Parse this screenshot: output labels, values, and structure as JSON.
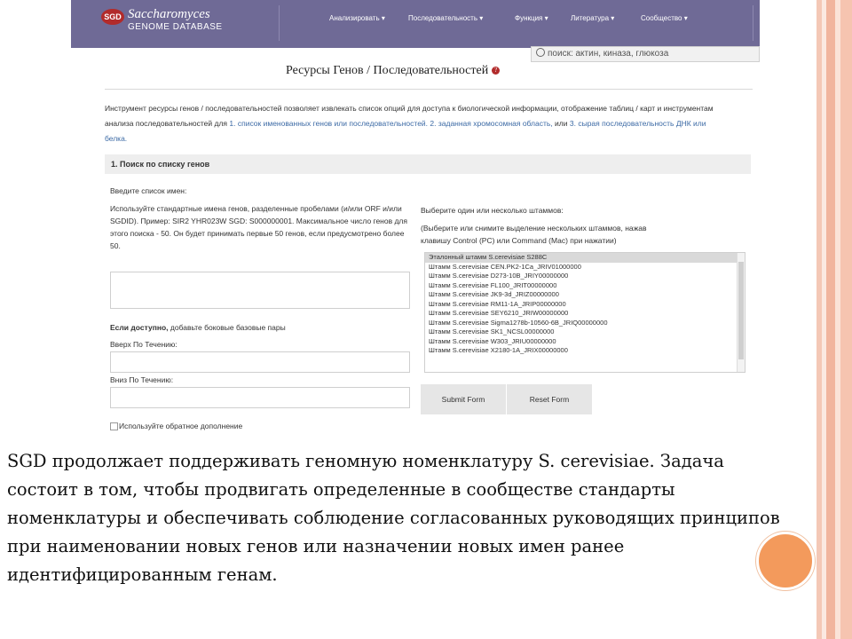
{
  "site": {
    "logo_text": "SGD",
    "brand_line1": "Saccharomyces",
    "brand_line2": "GENOME DATABASE"
  },
  "nav": {
    "items": [
      "Анализировать",
      "Последовательность",
      "Функция",
      "Литература",
      "Сообщество"
    ],
    "search_placeholder": "поиск: актин, киназа, глюкоза"
  },
  "page": {
    "title": "Ресурсы Генов / Последовательностей",
    "intro_part1": "Инструмент ресурсы генов / последовательностей позволяет извлекать список опций для доступа к биологической информации, отображение таблиц / карт и инструментам анализа последовательностей для",
    "intro_link1": "1. список именованных генов или последовательностей.",
    "intro_link2": "2. заданная хромосомная область,",
    "intro_mid": "или",
    "intro_link3": "3. сырая последовательность ДНК или белка."
  },
  "form": {
    "panel_title": "1. Поиск по списку генов",
    "names_label": "Введите список имен:",
    "names_help": "Используйте стандартные имена генов, разделенные пробелами (и/или ORF и/или SGDID). Пример: SIR2 YHR023W SGD: S000000001. Максимальное число генов для этого поиска - 50. Он будет принимать первые 50 генов, если предусмотрено более 50.",
    "flank_label_bold": "Если доступно,",
    "flank_label_rest": "добавьте боковые базовые пары",
    "upstream_label": "Вверх По Течению:",
    "downstream_label": "Вниз По Течению:",
    "reverse_label": "Используйте обратное дополнение",
    "strains_label": "Выберите один или несколько штаммов:",
    "strains_help": "(Выберите или снимите выделение нескольких штаммов, нажав клавишу Control (PC) или Command (Mac) при нажатии)",
    "strains": [
      "Эталонный штамм S.cerevisiae S288C",
      "Штамм S.cerevisiae CEN.PK2-1Ca_JRIV01000000",
      "Штамм S.cerevisiae D273-10B_JRIY00000000",
      "Штамм S.cerevisiae FL100_JRIT00000000",
      "Штамм S.cerevisiae JK9-3d_JRIZ00000000",
      "Штамм S.cerevisiae RM11-1A_JRIP00000000",
      "Штамм S.cerevisiae SEY6210_JRIW00000000",
      "Штамм S.cerevisiae Sigma1278b-10560-6B_JRIQ00000000",
      "Штамм S.cerevisiae SK1_NCSL00000000",
      "Штамм S.cerevisiae W303_JRIU00000000",
      "Штамм S.cerevisiae X2180-1A_JRIX00000000"
    ],
    "submit_label": "Submit Form",
    "reset_label": "Reset Form"
  },
  "slide": {
    "body": "SGD продолжает поддерживать геномную номенклатуру S. cerevisiae. Задача состоит в том, чтобы продвигать определенные в сообществе стандарты номенклатуры и обеспечивать соблюдение согласованных руководящих принципов при наименовании новых генов или назначении новых имен ранее идентифицированным генам."
  },
  "colors": {
    "nav_bg": "#6f6a96",
    "logo_red": "#b22b2b",
    "link_blue": "#3c6aa5",
    "accent_orange": "#f39a5c"
  }
}
